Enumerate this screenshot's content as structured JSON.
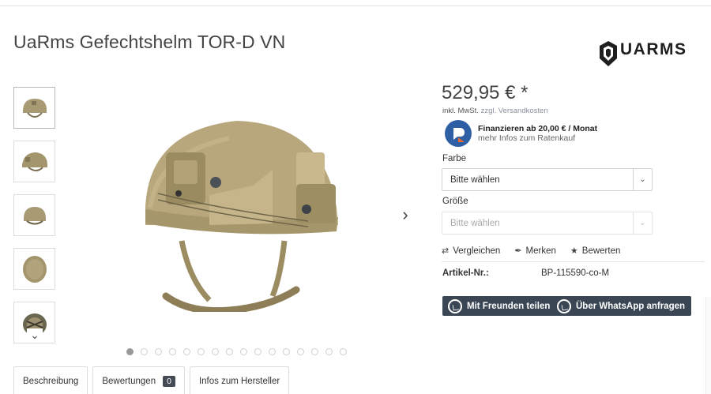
{
  "product": {
    "title": "UaRms Gefechtshelm TOR-D VN",
    "price": "529,95 € *",
    "tax_prefix": "inkl. MwSt.",
    "shipping_link": "zzgl. Versandkosten",
    "finance_line1": "Finanzieren ab 20,00 € / Monat",
    "finance_line2": "mehr Infos zum Ratenkauf"
  },
  "brand": {
    "logo_text": "UARMS"
  },
  "options": {
    "color_label": "Farbe",
    "color_value": "Bitte wählen",
    "size_label": "Größe",
    "size_value": "Bitte wählen"
  },
  "actions": {
    "compare": "Vergleichen",
    "remember": "Merken",
    "rate": "Bewerten"
  },
  "details": {
    "article_label": "Artikel-Nr.:",
    "article_value": "BP-115590-co-M"
  },
  "share": {
    "friends": "Mit Freunden teilen",
    "whatsapp": "Über WhatsApp anfragen"
  },
  "tabs": [
    {
      "label": "Beschreibung"
    },
    {
      "label": "Bewertungen",
      "badge": "0"
    },
    {
      "label": "Infos zum Hersteller"
    }
  ],
  "gallery": {
    "thumbnail_count": 5,
    "dot_count": 16,
    "active_index": 0
  },
  "colors": {
    "helmet": "#b8a77d",
    "button_dark": "#3a4654",
    "finance_blue": "#2e5fa5",
    "finance_orange": "#e8692d"
  },
  "icons": {
    "next": "chevron-right-icon",
    "thumb_down": "chevron-down-icon",
    "compare": "arrows-icon",
    "remember": "paperclip-icon",
    "rate": "star-icon",
    "whatsapp": "whatsapp-icon"
  }
}
